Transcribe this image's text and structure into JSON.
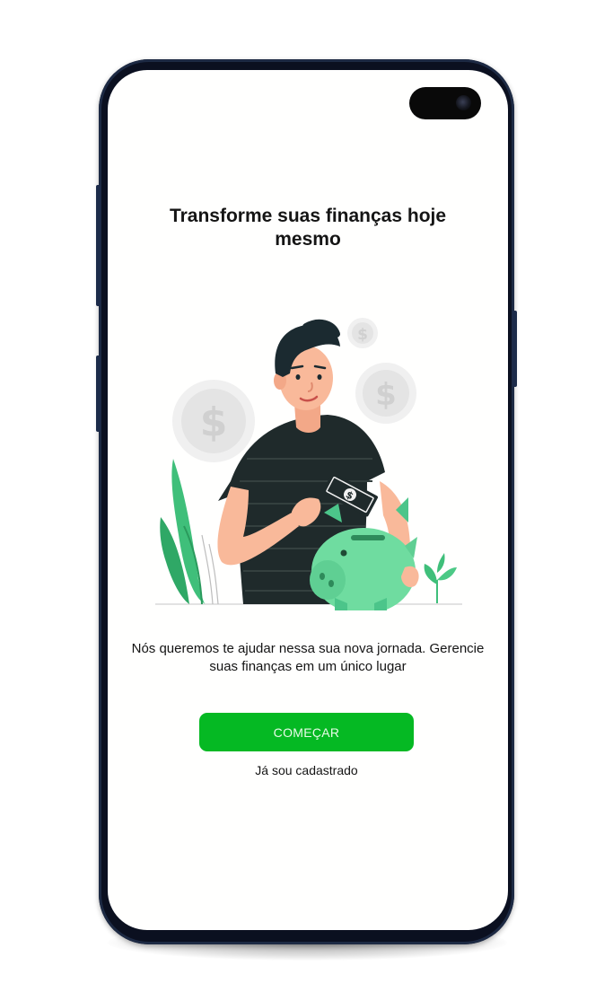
{
  "onboarding": {
    "title": "Transforme suas finanças hoje mesmo",
    "subtitle": "Nós queremos te ajudar nessa sua nova jornada. Gerencie suas finanças em um único lugar",
    "primary_button_label": "COMEÇAR",
    "secondary_link_label": "Já sou cadastrado"
  },
  "illustration": {
    "subject": "man-putting-money-into-piggy-bank",
    "coin_symbol": "$"
  },
  "colors": {
    "accent": "#05b923",
    "piggy": "#6fdca0",
    "shirt": "#1f2a2b",
    "plant": "#3fbf7a"
  }
}
